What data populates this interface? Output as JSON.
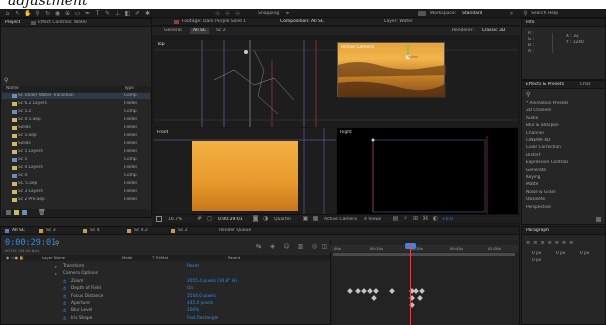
{
  "toolbar": {
    "snapping_label": "Snapping",
    "workspace_label": "Workspace:",
    "workspace_value": "Standard",
    "search_placeholder": "Search Help"
  },
  "project_panel": {
    "tab_label": "Project",
    "effect_controls_label": "Effect Controls: Water",
    "col_name": "Name",
    "col_type": "Type",
    "items": [
      {
        "name": "Sc Under Water Transition",
        "type": "Comp",
        "kind": "comp"
      },
      {
        "name": "Sc 6.2 Layers",
        "type": "Folder",
        "kind": "folder"
      },
      {
        "name": "Sc 5.2",
        "type": "Comp",
        "kind": "comp"
      },
      {
        "name": "Sc 4 5.aep",
        "type": "Folder",
        "kind": "folder"
      },
      {
        "name": "Solids",
        "type": "Folder",
        "kind": "folder"
      },
      {
        "name": "Sc 5.aep",
        "type": "Folder",
        "kind": "folder"
      },
      {
        "name": "Solids",
        "type": "Folder",
        "kind": "folder"
      },
      {
        "name": "Sc 5 Layers",
        "type": "Folder",
        "kind": "folder"
      },
      {
        "name": "Sc 5",
        "type": "Comp",
        "kind": "comp"
      },
      {
        "name": "Sc 4 Layers",
        "type": "Folder",
        "kind": "folder"
      },
      {
        "name": "Sc 4",
        "type": "Comp",
        "kind": "comp"
      },
      {
        "name": "SC 5.aep",
        "type": "Folder",
        "kind": "folder"
      },
      {
        "name": "Sc 3 Layers",
        "type": "Folder",
        "kind": "folder"
      },
      {
        "name": "Sc 2 Pre.aep",
        "type": "Folder",
        "kind": "folder"
      }
    ]
  },
  "viewer": {
    "tab_footage": "Footage: Dark Purple Solid 1",
    "tab_composition": "Composition: All SC",
    "tab_layer": "Layer: Water",
    "general_label": "General",
    "all_sc_label": "All SC",
    "sc2_label": "Sc 2",
    "renderer_label": "Renderer:",
    "renderer_value": "Classic 3D",
    "top_label": "Top",
    "front_label": "Front",
    "right_label": "Right",
    "active_camera_label": "Active Camera",
    "zoom_value": "16.7%",
    "time_value": "0:00:29:01",
    "resolution_value": "Quarter",
    "camera_value": "Active Camera",
    "views_value": "4 Views",
    "exposure_value": "+0.0"
  },
  "info_panel": {
    "tab_label": "Info",
    "r": "R :",
    "g": "G :",
    "b": "B :",
    "a": "A :",
    "x": "X : 32",
    "y": "Y : 1240"
  },
  "effects_panel": {
    "tab_label": "Effects & Presets",
    "tab2_label": "Char",
    "items": [
      "* Animation Presets",
      "3D Channel",
      "Audio",
      "Blur & Sharpen",
      "Channel",
      "CINEMA 4D",
      "Color Correction",
      "Distort",
      "Expression Controls",
      "Generate",
      "Keying",
      "Matte",
      "Noise & Grain",
      "Obsolete",
      "Perspective"
    ]
  },
  "paragraph_panel": {
    "tab_label": "Paragraph",
    "px1": "0 px",
    "px2": "0 px",
    "px3": "0 px",
    "px4": "0 px"
  },
  "timeline": {
    "tabs": [
      "All SC",
      "Sc 3",
      "Sc 4",
      "Sc 4.2",
      "Sc 2",
      "Render Queue"
    ],
    "timecode": "0:00:29:01",
    "fps": "00741 (24.00 fps)",
    "col_layer": "Layer Name",
    "col_mode": "Mode",
    "col_trkmat": "T TrkMat",
    "col_parent": "Parent",
    "ruler": [
      "00s",
      "00:15s",
      "00:30s",
      "00:45s",
      "01:00s"
    ],
    "layers": [
      {
        "name": "Transform",
        "value": "Reset",
        "indent": 20
      },
      {
        "name": "Camera Options",
        "value": "",
        "indent": 20
      },
      {
        "name": "Zoom",
        "value": "2055.4 pixels (34.8° H)",
        "indent": 28
      },
      {
        "name": "Depth of Field",
        "value": "On",
        "indent": 28
      },
      {
        "name": "Focus Distance",
        "value": "2544.0 pixels",
        "indent": 28
      },
      {
        "name": "Aperture",
        "value": "445.0 pixels",
        "indent": 28
      },
      {
        "name": "Blur Level",
        "value": "100%",
        "indent": 28
      },
      {
        "name": "Iris Shape",
        "value": "Fast Rectangle",
        "indent": 28
      }
    ]
  }
}
